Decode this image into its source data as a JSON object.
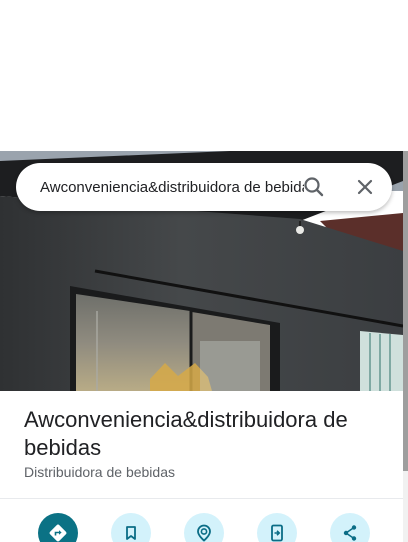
{
  "search": {
    "value": "Awconveniencia&distribuidora de bebidas"
  },
  "place": {
    "name": "Awconveniencia&distribuidora de bebidas",
    "category": "Distribuidora de bebidas"
  },
  "icons": {
    "search": "search-icon",
    "clear": "close-icon",
    "directions": "directions-icon",
    "save": "bookmark-icon",
    "nearby": "nearby-icon",
    "send_to_phone": "send-to-phone-icon",
    "share": "share-icon"
  },
  "colors": {
    "primary": "#0b7285",
    "action_tint": "#d3f2fb",
    "action_icon": "#0b6d86",
    "title": "#202124",
    "subtitle": "#5f6368"
  }
}
